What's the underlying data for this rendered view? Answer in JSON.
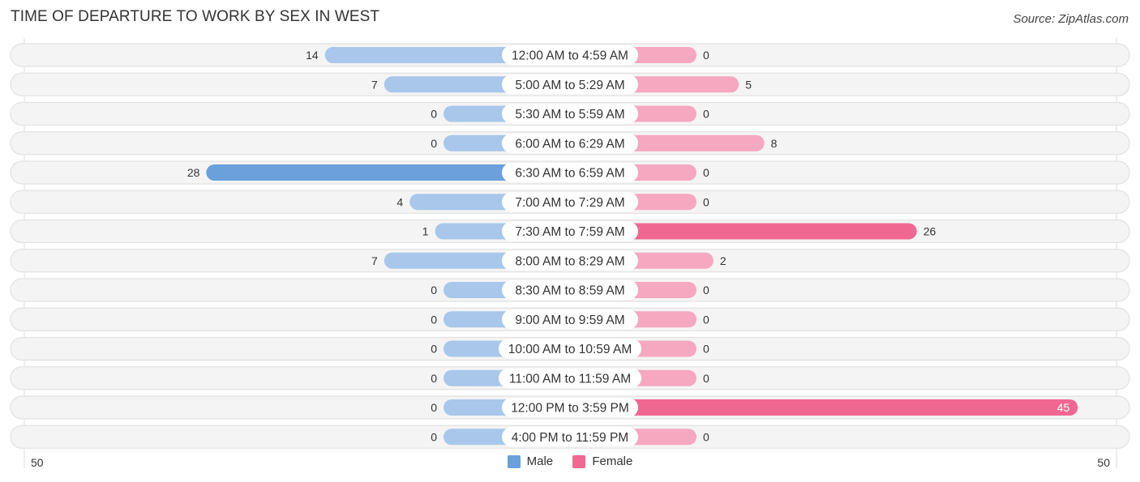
{
  "header": {
    "title": "TIME OF DEPARTURE TO WORK BY SEX IN WEST",
    "source": "Source: ZipAtlas.com"
  },
  "colors": {
    "male_strong": "#6aa0dc",
    "male_light": "#a8c7ea",
    "female_strong": "#f06892",
    "female_light": "#f5a8c0",
    "row_bg": "#f2f2f2"
  },
  "axis": {
    "left_label": "50",
    "right_label": "50"
  },
  "legend": [
    {
      "label": "Male",
      "color": "#6aa0dc"
    },
    {
      "label": "Female",
      "color": "#f06892"
    }
  ],
  "chart_data": {
    "type": "bar",
    "orientation": "horizontal-diverging",
    "title": "TIME OF DEPARTURE TO WORK BY SEX IN WEST",
    "xlim": [
      -50,
      50
    ],
    "categories": [
      "12:00 AM to 4:59 AM",
      "5:00 AM to 5:29 AM",
      "5:30 AM to 5:59 AM",
      "6:00 AM to 6:29 AM",
      "6:30 AM to 6:59 AM",
      "7:00 AM to 7:29 AM",
      "7:30 AM to 7:59 AM",
      "8:00 AM to 8:29 AM",
      "8:30 AM to 8:59 AM",
      "9:00 AM to 9:59 AM",
      "10:00 AM to 10:59 AM",
      "11:00 AM to 11:59 AM",
      "12:00 PM to 3:59 PM",
      "4:00 PM to 11:59 PM"
    ],
    "series": [
      {
        "name": "Male",
        "values": [
          14,
          7,
          0,
          0,
          28,
          4,
          1,
          7,
          0,
          0,
          0,
          0,
          0,
          0
        ]
      },
      {
        "name": "Female",
        "values": [
          0,
          5,
          0,
          8,
          0,
          0,
          26,
          2,
          0,
          0,
          0,
          0,
          45,
          0
        ]
      }
    ],
    "legend": [
      "Male",
      "Female"
    ],
    "legend_position": "bottom-center"
  }
}
